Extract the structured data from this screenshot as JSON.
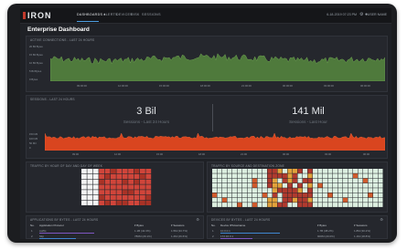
{
  "app": {
    "logo": "IRON",
    "page_title": "Enterprise Dashboard",
    "timestamp": "6-18-2019 07:23 PM",
    "user_label": "USER NAME"
  },
  "nav": {
    "items": [
      {
        "label": "DASHBOARDS ▾",
        "active": true
      },
      {
        "label": "ALERTS",
        "active": false
      },
      {
        "label": "DEVICES",
        "active": false
      },
      {
        "label": "RISK",
        "active": false
      },
      {
        "label": "SESSIONS",
        "active": false
      }
    ]
  },
  "panels": {
    "top_chart": {
      "title": "ACTIVE CONNECTIONS - LAST 24 HOURS",
      "color": "#4f7a3c",
      "y_labels": [
        "20 Bil Bytes",
        "15 Bil Bytes",
        "10 Bil Bytes",
        "5 Bil Bytes",
        "0 Bytes"
      ],
      "x_labels": [
        "09:00:00",
        "12:00:00",
        "15:00:00",
        "18:00:00",
        "21:00:00",
        "00:00:00",
        "03:00:00",
        "06:00:00"
      ]
    },
    "sessions": {
      "title": "SESSIONS - LAST 24 HOURS",
      "left_value": "3 Bil",
      "left_caption": "Sessions - Last 24 Hours",
      "right_value": "141 Mil",
      "right_caption": "Sessions - Last Hour",
      "color": "#d9451f",
      "y_labels": [
        "150 Mil",
        "100 Mil",
        "50 Mil",
        "0"
      ],
      "x_labels": [
        "09:00",
        "12:00",
        "15:00",
        "18:00",
        "21:00",
        "00:00",
        "03:00",
        "06:00"
      ]
    },
    "heat_left": {
      "title": "TRAFFIC BY HOUR OF DAY AND DAY OF WEEK",
      "x_labels": [
        "Mon",
        "Tue",
        "Wed",
        "Thu",
        "Fri",
        "Sat",
        "Sun"
      ],
      "base_color": "#c0392b"
    },
    "heat_right": {
      "title": "TRAFFIC BY SOURCE AND DESTINATION ZONE",
      "base_color": "#e6f0e6",
      "hot_color": "#b03a2e"
    },
    "table_left": {
      "title": "APPLICATIONS BY BYTES - LAST 24 HOURS",
      "columns": [
        "No.",
        "Application Protocol",
        "▾ Bytes",
        "▾ Sessions"
      ],
      "rows": [
        {
          "no": "1",
          "name": "ssl/tls",
          "bytes": "1.1B (42.3%)",
          "sessions": "1.5M (33.7%)",
          "bar_color": "#7e57c2"
        },
        {
          "no": "2",
          "name": "http",
          "bytes": "780M (29.1%)",
          "sessions": "1.2M (26.6%)",
          "bar_color": "#3f86d1"
        }
      ]
    },
    "table_right": {
      "title": "DEVICES BY BYTES - LAST 24 HOURS",
      "columns": [
        "No.",
        "Device IP/Hostname",
        "▾ Bytes",
        "▾ Sessions"
      ],
      "rows": [
        {
          "no": "1",
          "name": "10.0.0.1",
          "bytes": "1.7B (38.2%)",
          "sessions": "1.8M (30.2%)",
          "bar_color": "#3f86d1"
        },
        {
          "no": "2",
          "name": "172.16.0.1",
          "bytes": "900M (20.0%)",
          "sessions": "1.1M (18.8%)",
          "bar_color": "#7e57c2"
        }
      ]
    }
  }
}
